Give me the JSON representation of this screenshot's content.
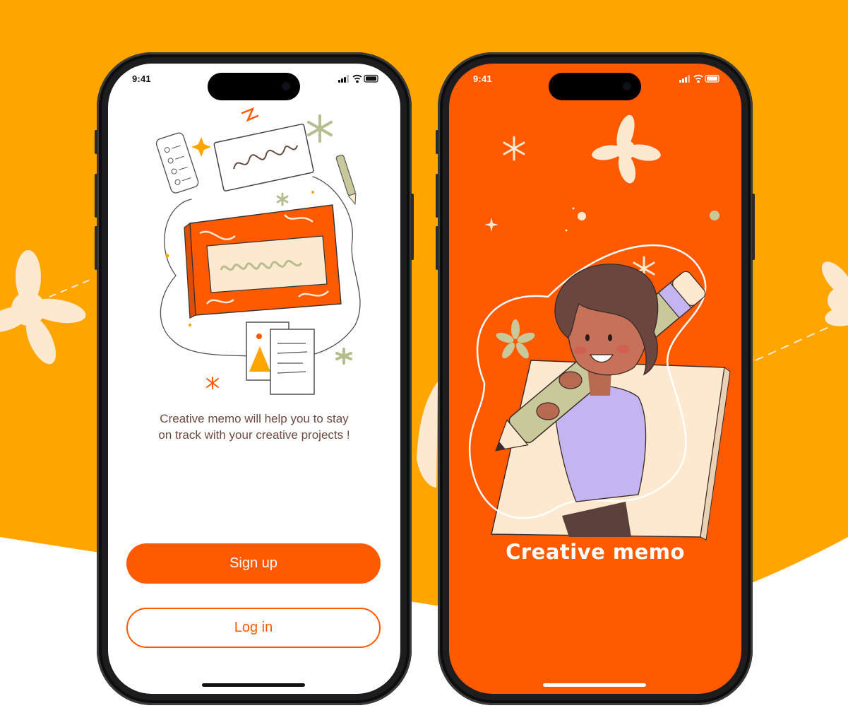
{
  "colors": {
    "background_orange": "#ffa500",
    "brand_orange": "#ff5a00",
    "cream": "#fde9cf",
    "tagline_brown": "#6d4a3f",
    "sage": "#c8c89a"
  },
  "phones": {
    "left": {
      "status_time": "9:41",
      "tagline_line1": "Creative memo will help you to stay",
      "tagline_line2": "on track with your creative projects !",
      "signup_label": "Sign up",
      "login_label": "Log in"
    },
    "right": {
      "status_time": "9:41",
      "brand_title": "Creative memo"
    }
  },
  "icons": [
    "cellular-signal-icon",
    "wifi-icon",
    "battery-icon",
    "notebook-illustration",
    "woman-with-pencil-illustration",
    "sparkle-icon"
  ]
}
